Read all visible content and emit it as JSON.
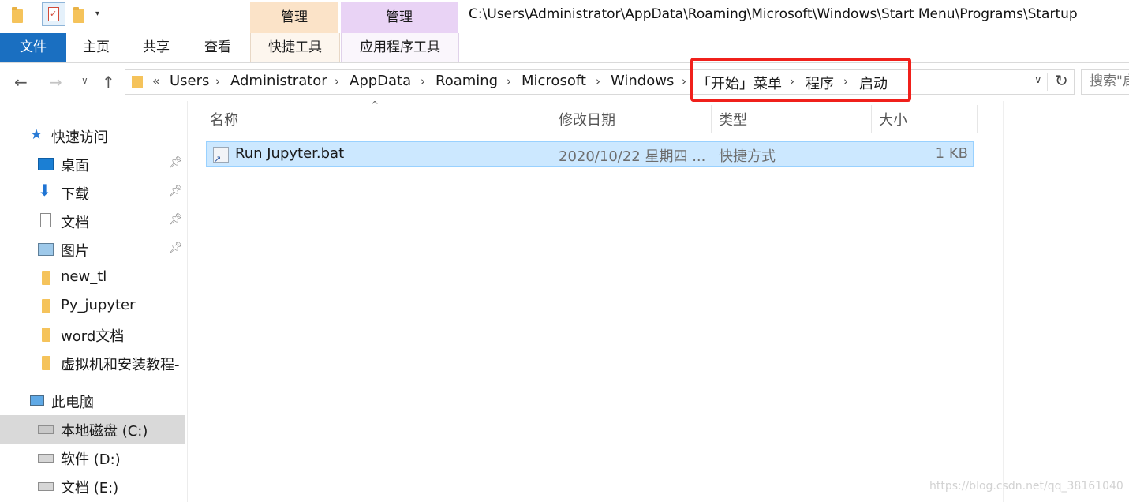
{
  "titlebar": {
    "path": "C:\\Users\\Administrator\\AppData\\Roaming\\Microsoft\\Windows\\Start Menu\\Programs\\Startup",
    "context_tabs": [
      "管理",
      "管理"
    ]
  },
  "ribbon": {
    "tabs": [
      "文件",
      "主页",
      "共享",
      "查看",
      "快捷工具",
      "应用程序工具"
    ]
  },
  "address": {
    "overflow": "«",
    "crumbs": [
      "Users",
      "Administrator",
      "AppData",
      "Roaming",
      "Microsoft",
      "Windows",
      "「开始」菜单",
      "程序",
      "启动"
    ],
    "separator": "›"
  },
  "search": {
    "placeholder": "搜索\"启动\""
  },
  "sidebar": {
    "quick_access": "快速访问",
    "items": [
      {
        "label": "桌面",
        "icon": "desktop-icon",
        "pinned": true
      },
      {
        "label": "下载",
        "icon": "download-icon",
        "pinned": true
      },
      {
        "label": "文档",
        "icon": "document-icon",
        "pinned": true
      },
      {
        "label": "图片",
        "icon": "pictures-icon",
        "pinned": true
      },
      {
        "label": "new_tl",
        "icon": "folder-icon",
        "pinned": false
      },
      {
        "label": "Py_jupyter",
        "icon": "folder-icon",
        "pinned": false
      },
      {
        "label": "word文档",
        "icon": "folder-icon",
        "pinned": false
      },
      {
        "label": "虚拟机和安装教程-",
        "icon": "folder-icon",
        "pinned": false
      }
    ],
    "this_pc": "此电脑",
    "drives": [
      {
        "label": "本地磁盘 (C:)",
        "selected": true
      },
      {
        "label": "软件 (D:)",
        "selected": false
      },
      {
        "label": "文档 (E:)",
        "selected": false
      }
    ]
  },
  "filelist": {
    "columns": [
      "名称",
      "修改日期",
      "类型",
      "大小"
    ],
    "rows": [
      {
        "name": "Run Jupyter.bat",
        "modified": "2020/10/22 星期四 ...",
        "type": "快捷方式",
        "size": "1 KB"
      }
    ]
  },
  "watermark": "https://blog.csdn.net/qq_38161040",
  "colors": {
    "file_tab": "#1a6fc1",
    "selection": "#cce8ff",
    "highlight_box": "#f0201b"
  }
}
